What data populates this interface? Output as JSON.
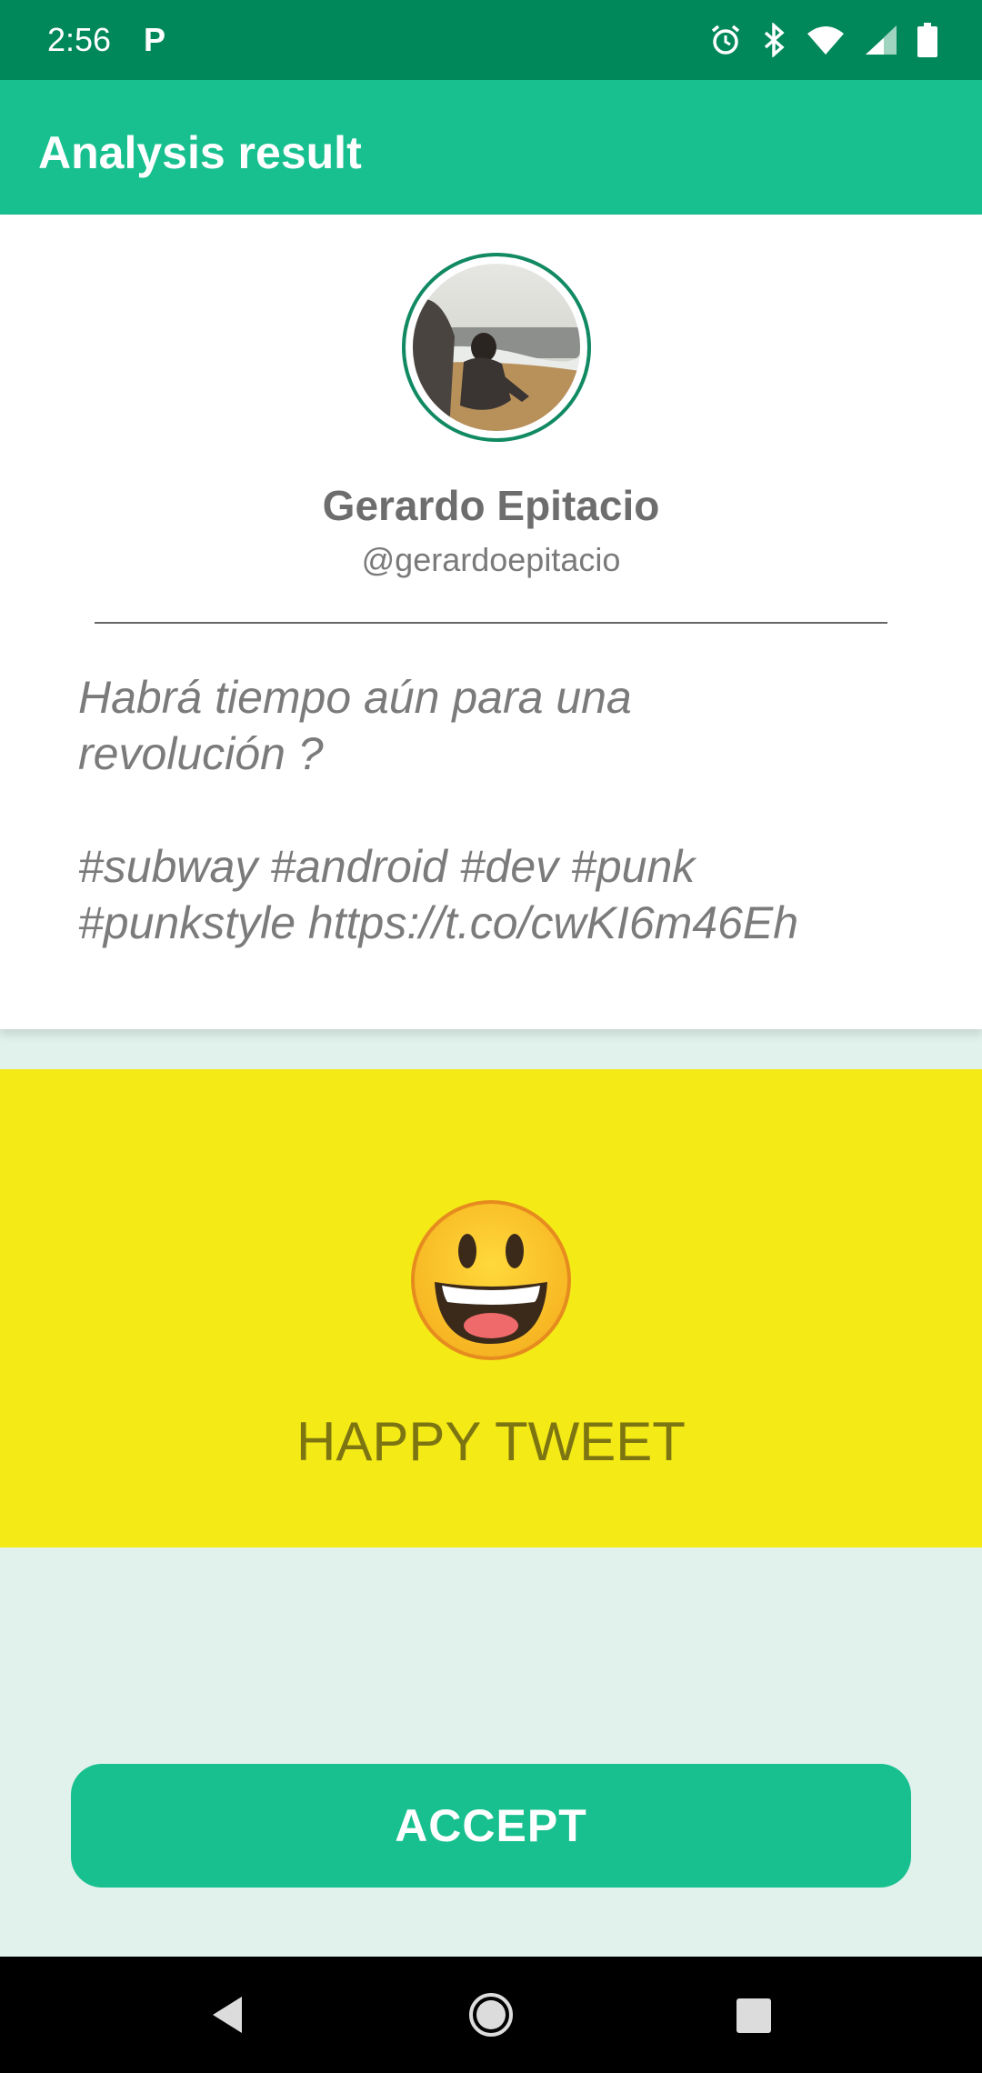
{
  "status_bar": {
    "time": "2:56",
    "notification": "P",
    "icons": [
      "alarm-icon",
      "bluetooth-icon",
      "wifi-icon",
      "cell-signal-icon",
      "battery-icon"
    ]
  },
  "app_bar": {
    "title": "Analysis result"
  },
  "tweet": {
    "user_name": "Gerardo Epitacio",
    "handle": "@gerardoepitacio",
    "text": "Habrá tiempo aún para una\nrevolución ?\n\n#subway #android #dev #punk\n#punkstyle https://t.co/cwKI6m46Eh"
  },
  "result": {
    "icon": "smiley-emoji-icon",
    "label": "HAPPY TWEET",
    "background_color": "#f4ea16"
  },
  "actions": {
    "accept_label": "ACCEPT"
  },
  "colors": {
    "status_bar": "#00875a",
    "app_bar": "#17c08e",
    "accent": "#17c08e",
    "page_background": "#e1f1ec"
  },
  "nav_bar": {
    "icons": [
      "back-icon",
      "home-icon",
      "recents-icon"
    ]
  }
}
